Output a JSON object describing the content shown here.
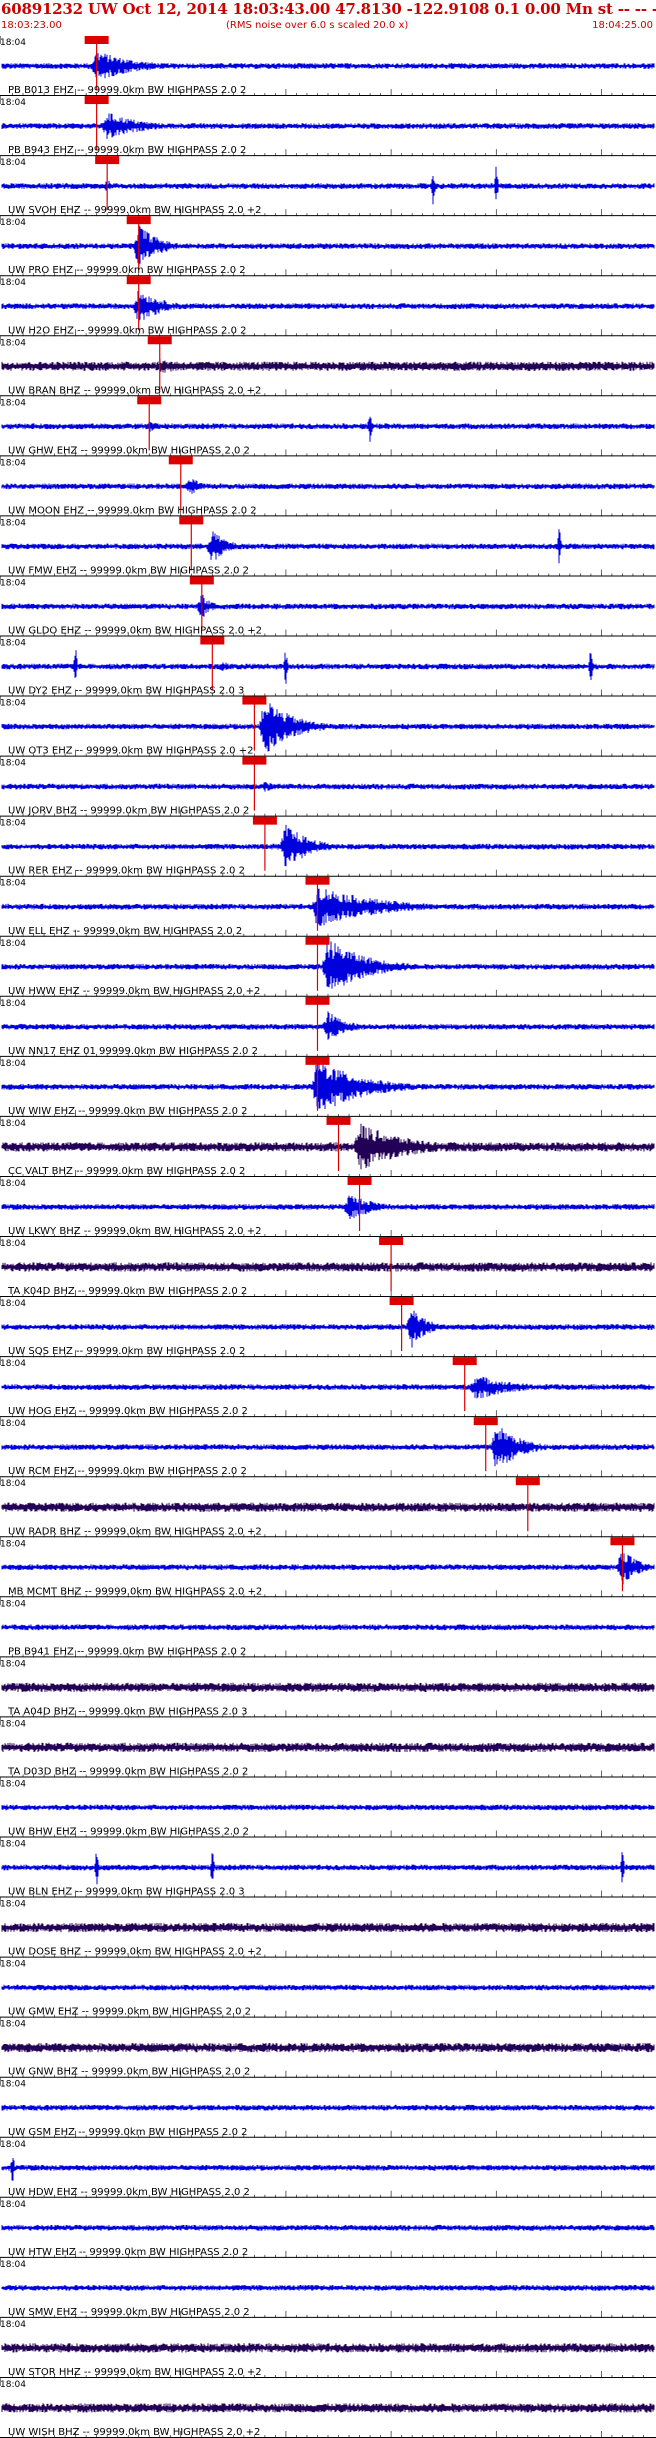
{
  "header": {
    "title": "60891232 UW Oct 12, 2014 18:03:43.00   47.8130 -122.9108  0.1 0.00 Mn st -- -- --  -1",
    "start_time": "18:03:23.00",
    "note": "(RMS noise over 6.0 s scaled 20.0 x)",
    "end_time": "18:04:25.00",
    "colors": {
      "header_text": "#cc0000",
      "trace": "#0000dd",
      "trace_dark": "#220055",
      "pick_box": "#dd0000",
      "pick_line": "#dd0000"
    }
  },
  "chart_data": {
    "type": "line",
    "title": "60891232 UW Oct 12, 2014 18:03:43.00   47.8130 -122.9108  0.1 0.00 Mn st -- -- --  -1",
    "x_range": [
      "18:03:23.00",
      "18:04:25.00"
    ],
    "x_tick_label": "18:04",
    "grid": false,
    "legend": "none",
    "series": [
      {
        "name": "PB B013 EHZ -- 99999.0km BW  HIGHPASS  2.0  2",
        "pick": "18:03:32",
        "burst": "18:03:32",
        "amp": 0.55,
        "dur": 8,
        "dark": false,
        "spikes": []
      },
      {
        "name": "PB B943 EHZ -- 99999.0km BW  HIGHPASS  2.0  2",
        "pick": "18:03:32",
        "burst": "18:03:33",
        "amp": 0.5,
        "dur": 7,
        "dark": false,
        "spikes": []
      },
      {
        "name": "UW SVOH EHZ -- 99999.0km BW  HIGHPASS  2.0 +2",
        "pick": "18:03:33",
        "burst": "18:03:33",
        "amp": 0.22,
        "dur": 2,
        "dark": false,
        "spikes": [
          "18:04:04",
          "18:04:10"
        ]
      },
      {
        "name": "UW PRO EHZ -- 99999.0km BW  HIGHPASS  2.0  2",
        "pick": "18:03:36",
        "burst": "18:03:36",
        "amp": 0.8,
        "dur": 4,
        "dark": false,
        "spikes": []
      },
      {
        "name": "UW H2O EHZ -- 99999.0km BW  HIGHPASS  2.0  2",
        "pick": "18:03:36",
        "burst": "18:03:36",
        "amp": 0.6,
        "dur": 5,
        "dark": false,
        "spikes": []
      },
      {
        "name": "UW BRAN BHZ -- 99999.0km BW  HIGHPASS  2.0 +2",
        "pick": "18:03:38",
        "burst": "18:03:38",
        "amp": 0.25,
        "dur": 10,
        "dark": true,
        "spikes": []
      },
      {
        "name": "UW GHW EHZ -- 99999.0km BW  HIGHPASS  2.0  2",
        "pick": "18:03:37",
        "burst": "18:03:37",
        "amp": 0.2,
        "dur": 3,
        "dark": false,
        "spikes": [
          "18:03:58"
        ]
      },
      {
        "name": "UW MOON EHZ -- 99999.0km BW  HIGHPASS  2.0  2",
        "pick": "18:03:40",
        "burst": "18:03:41",
        "amp": 0.35,
        "dur": 2,
        "dark": false,
        "spikes": []
      },
      {
        "name": "UW FMW EHZ -- 99999.0km BW  HIGHPASS  2.0  2",
        "pick": "18:03:41",
        "burst": "18:03:43",
        "amp": 0.6,
        "dur": 3,
        "dark": false,
        "spikes": [
          "18:04:16"
        ]
      },
      {
        "name": "UW GLDO EHZ -- 99999.0km BW  HIGHPASS  2.0 +2",
        "pick": "18:03:42",
        "burst": "18:03:42",
        "amp": 0.45,
        "dur": 2,
        "dark": false,
        "spikes": []
      },
      {
        "name": "UW DY2 EHZ -- 99999.0km BW  HIGHPASS  2.0  3",
        "pick": "18:03:43",
        "burst": "18:03:44",
        "amp": 0.2,
        "dur": 2,
        "dark": false,
        "spikes": [
          "18:03:30",
          "18:03:50",
          "18:04:19"
        ]
      },
      {
        "name": "UW OT3 EHZ -- 99999.0km BW  HIGHPASS  2.0 +2",
        "pick": "18:03:47",
        "burst": "18:03:48",
        "amp": 1.0,
        "dur": 6,
        "dark": false,
        "spikes": []
      },
      {
        "name": "UW JORV BHZ -- 99999.0km BW  HIGHPASS  2.0  2",
        "pick": "18:03:47",
        "burst": "18:03:48",
        "amp": 0.2,
        "dur": 3,
        "dark": false,
        "spikes": []
      },
      {
        "name": "UW RER EHZ -- 99999.0km BW  HIGHPASS  2.0  2",
        "pick": "18:03:48",
        "burst": "18:03:50",
        "amp": 0.8,
        "dur": 5,
        "dark": false,
        "spikes": []
      },
      {
        "name": "UW ELL EHZ -- 99999.0km BW  HIGHPASS  2.0  2",
        "pick": "18:03:53",
        "burst": "18:03:53",
        "amp": 0.75,
        "dur": 12,
        "dark": false,
        "spikes": []
      },
      {
        "name": "UW HWW EHZ -- 99999.0km BW  HIGHPASS  2.0 +2",
        "pick": "18:03:53",
        "burst": "18:03:54",
        "amp": 1.0,
        "dur": 8,
        "dark": false,
        "spikes": []
      },
      {
        "name": "UW NN17 EHZ 01 99999.0km BW  HIGHPASS  2.0  2",
        "pick": "18:03:53",
        "burst": "18:03:54",
        "amp": 0.55,
        "dur": 4,
        "dark": false,
        "spikes": []
      },
      {
        "name": "UW WIW EHZ -- 99999.0km BW  HIGHPASS  2.0  2",
        "pick": "18:03:53",
        "burst": "18:03:53",
        "amp": 1.0,
        "dur": 9,
        "dark": false,
        "spikes": []
      },
      {
        "name": "CC VALT BHZ -- 99999.0km BW  HIGHPASS  2.0  2",
        "pick": "18:03:55",
        "burst": "18:03:57",
        "amp": 0.85,
        "dur": 10,
        "dark": true,
        "spikes": []
      },
      {
        "name": "UW LKWY BHZ -- 99999.0km BW  HIGHPASS  2.0 +2",
        "pick": "18:03:57",
        "burst": "18:03:56",
        "amp": 0.45,
        "dur": 6,
        "dark": false,
        "spikes": []
      },
      {
        "name": "TA K04D BHZ -- 99999.0km BW  HIGHPASS  2.0  2",
        "pick": "18:04:00",
        "burst": "18:04:01",
        "amp": 0.15,
        "dur": 2,
        "dark": true,
        "spikes": []
      },
      {
        "name": "UW SQS EHZ -- 99999.0km BW  HIGHPASS  2.0  2",
        "pick": "18:04:01",
        "burst": "18:04:02",
        "amp": 0.75,
        "dur": 3,
        "dark": false,
        "spikes": []
      },
      {
        "name": "UW HOG EHZ -- 99999.0km BW  HIGHPASS  2.0  2",
        "pick": "18:04:07",
        "burst": "18:04:08",
        "amp": 0.45,
        "dur": 8,
        "dark": false,
        "spikes": []
      },
      {
        "name": "UW RCM EHZ -- 99999.0km BW  HIGHPASS  2.0  2",
        "pick": "18:04:09",
        "burst": "18:04:10",
        "amp": 0.85,
        "dur": 5,
        "dark": false,
        "spikes": []
      },
      {
        "name": "UW RADR BHZ -- 99999.0km BW  HIGHPASS  2.0 +2",
        "pick": "18:04:13",
        "burst": "18:04:13",
        "amp": 0.15,
        "dur": 3,
        "dark": true,
        "spikes": []
      },
      {
        "name": "MB MCMT BHZ -- 99999.0km BW  HIGHPASS  2.0 +2",
        "pick": "18:04:22",
        "burst": "18:04:22",
        "amp": 0.7,
        "dur": 3,
        "dark": false,
        "spikes": []
      },
      {
        "name": "PB B941 EHZ -- 99999.0km BW  HIGHPASS  2.0  2",
        "pick": "",
        "burst": "",
        "amp": 0,
        "dur": 0,
        "dark": false,
        "spikes": []
      },
      {
        "name": "TA A04D BHZ -- 99999.0km BW  HIGHPASS  2.0  3",
        "pick": "",
        "burst": "",
        "amp": 0,
        "dur": 0,
        "dark": true,
        "spikes": []
      },
      {
        "name": "TA D03D BHZ -- 99999.0km BW  HIGHPASS  2.0  2",
        "pick": "",
        "burst": "",
        "amp": 0,
        "dur": 0,
        "dark": true,
        "spikes": []
      },
      {
        "name": "UW BHW EHZ -- 99999.0km BW  HIGHPASS  2.0  2",
        "pick": "",
        "burst": "",
        "amp": 0,
        "dur": 0,
        "dark": false,
        "spikes": []
      },
      {
        "name": "UW BLN EHZ -- 99999.0km BW  HIGHPASS  2.0  3",
        "pick": "",
        "burst": "",
        "amp": 0,
        "dur": 0,
        "dark": false,
        "spikes": [
          "18:03:32",
          "18:03:43",
          "18:04:22"
        ]
      },
      {
        "name": "UW DOSE BHZ -- 99999.0km BW  HIGHPASS  2.0 +2",
        "pick": "",
        "burst": "",
        "amp": 0,
        "dur": 0,
        "dark": true,
        "spikes": []
      },
      {
        "name": "UW GMW EHZ -- 99999.0km BW  HIGHPASS  2.0  2",
        "pick": "",
        "burst": "",
        "amp": 0,
        "dur": 0,
        "dark": false,
        "spikes": []
      },
      {
        "name": "UW GNW BHZ -- 99999.0km BW  HIGHPASS  2.0  2",
        "pick": "",
        "burst": "",
        "amp": 0,
        "dur": 0,
        "dark": true,
        "spikes": []
      },
      {
        "name": "UW GSM EHZ -- 99999.0km BW  HIGHPASS  2.0  2",
        "pick": "",
        "burst": "",
        "amp": 0,
        "dur": 0,
        "dark": false,
        "spikes": []
      },
      {
        "name": "UW HDW EHZ -- 99999.0km BW  HIGHPASS  2.0  2",
        "pick": "",
        "burst": "",
        "amp": 0,
        "dur": 0,
        "dark": false,
        "spikes": [
          "18:03:24"
        ]
      },
      {
        "name": "UW HTW EHZ -- 99999.0km BW  HIGHPASS  2.0  2",
        "pick": "",
        "burst": "",
        "amp": 0,
        "dur": 0,
        "dark": false,
        "spikes": []
      },
      {
        "name": "UW SMW EHZ -- 99999.0km BW  HIGHPASS  2.0  2",
        "pick": "",
        "burst": "",
        "amp": 0,
        "dur": 0,
        "dark": false,
        "spikes": []
      },
      {
        "name": "UW STOR HHZ -- 99999.0km BW  HIGHPASS  2.0 +2",
        "pick": "",
        "burst": "",
        "amp": 0,
        "dur": 0,
        "dark": true,
        "spikes": []
      },
      {
        "name": "UW WISH BHZ -- 99999.0km BW  HIGHPASS  2.0 +2",
        "pick": "",
        "burst": "",
        "amp": 0,
        "dur": 0,
        "dark": true,
        "spikes": []
      }
    ]
  }
}
